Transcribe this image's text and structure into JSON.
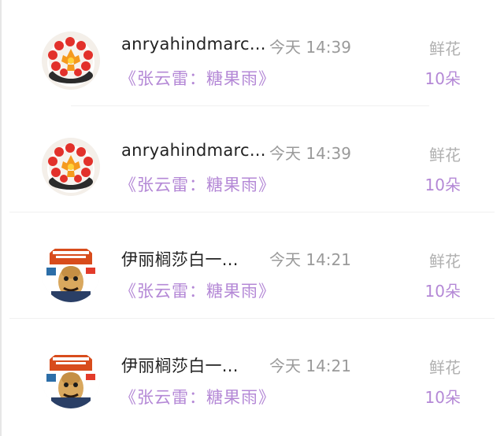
{
  "gift_list": [
    {
      "user": "anryahindmarc...",
      "time": "今天 14:39",
      "song": "《张云雷：糖果雨》",
      "gift_type": "鲜花",
      "gift_count": "10朵",
      "avatar_icon": "fruit-platter-avatar-icon"
    },
    {
      "user": "anryahindmarc...",
      "time": "今天 14:39",
      "song": "《张云雷：糖果雨》",
      "gift_type": "鲜花",
      "gift_count": "10朵",
      "avatar_icon": "fruit-platter-avatar-icon"
    },
    {
      "user": "伊丽榈莎白一...",
      "time": "今天 14:21",
      "song": "《张云雷：糖果雨》",
      "gift_type": "鲜花",
      "gift_count": "10朵",
      "avatar_icon": "cartoon-character-avatar-icon"
    },
    {
      "user": "伊丽榈莎白一...",
      "time": "今天 14:21",
      "song": "《张云雷：糖果雨》",
      "gift_type": "鲜花",
      "gift_count": "10朵",
      "avatar_icon": "cartoon-character-avatar-icon"
    }
  ],
  "colors": {
    "accent_purple": "#b488d6",
    "muted_gray": "#9a9a9a"
  }
}
